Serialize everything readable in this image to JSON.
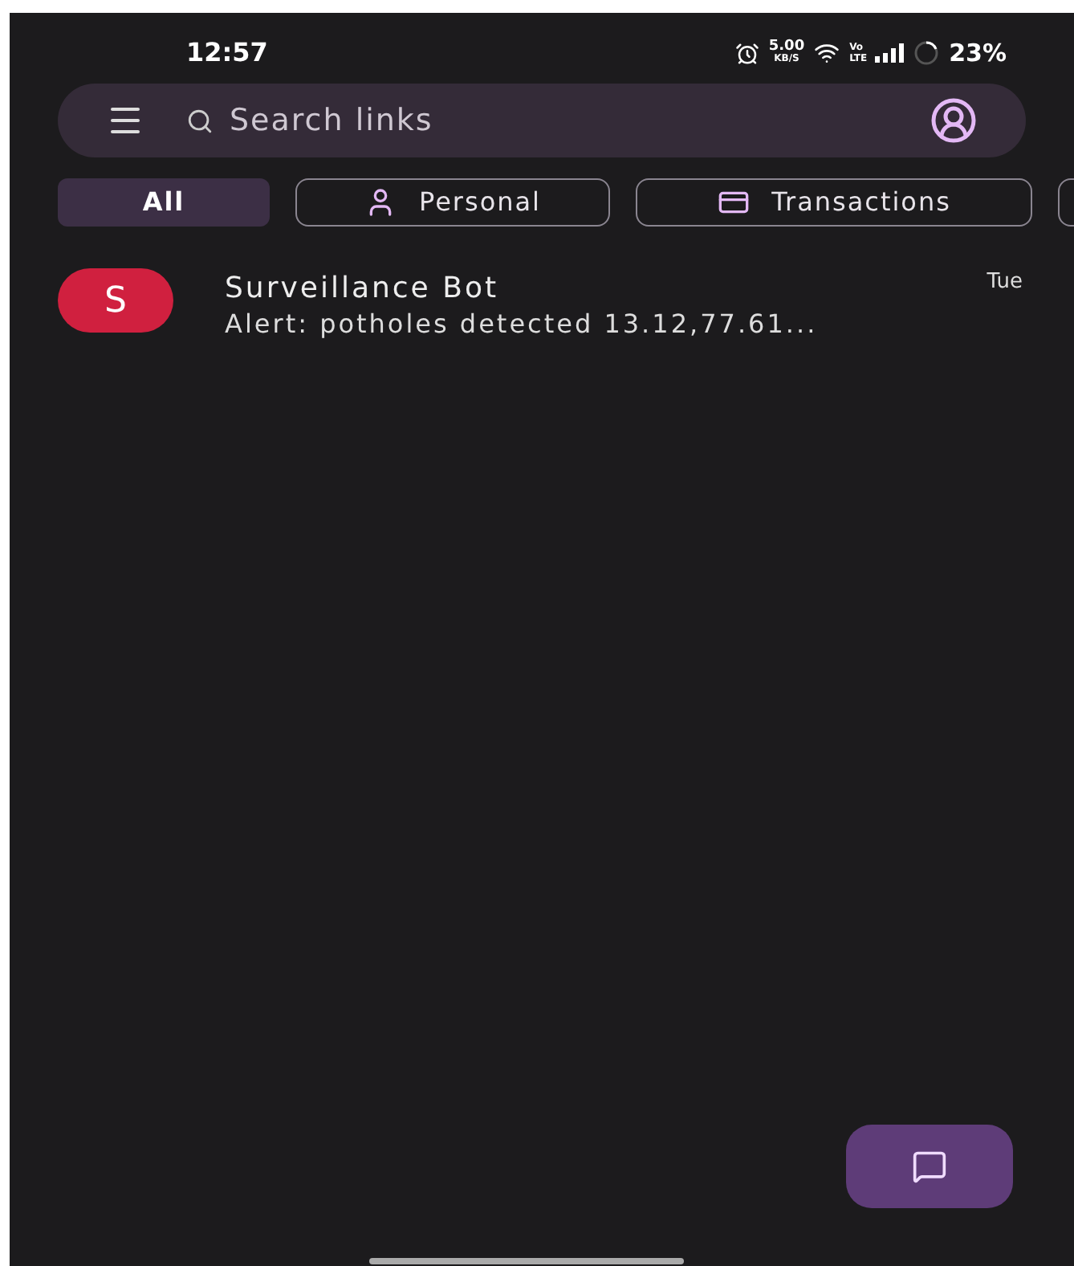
{
  "status_bar": {
    "time": "12:57",
    "speed_value": "5.00",
    "speed_unit": "KB/S",
    "network": "Vo LTE",
    "battery": "23%"
  },
  "search": {
    "placeholder": "Search links"
  },
  "filters": [
    {
      "label": "All",
      "kind": "plain",
      "selected": true
    },
    {
      "label": "Personal",
      "kind": "person",
      "selected": false
    },
    {
      "label": "Transactions",
      "kind": "card",
      "selected": false
    }
  ],
  "conversations": [
    {
      "initial": "S",
      "color": "#d0203f",
      "name": "Surveillance Bot",
      "preview": "Alert: potholes detected 13.12,77.61...",
      "time": "Tue"
    }
  ]
}
